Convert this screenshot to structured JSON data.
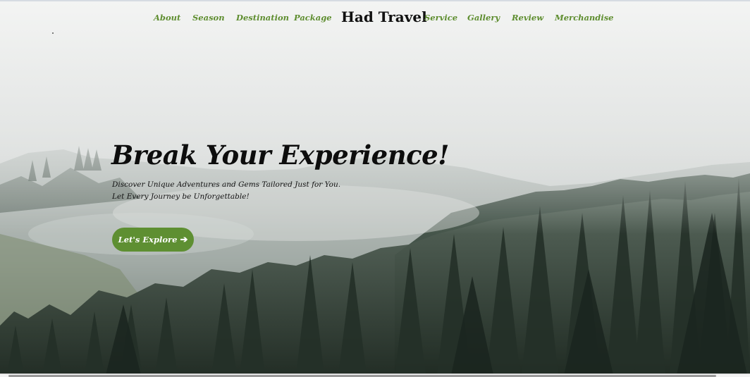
{
  "brand": "Had Travel",
  "nav": {
    "left": [
      "About",
      "Season",
      "Destination",
      "Package"
    ],
    "right": [
      "Service",
      "Gallery",
      "Review",
      "Merchandise"
    ]
  },
  "hero": {
    "headline": "Break Your Experience!",
    "subtitle_line1": "Discover Unique Adventures and Gems Tailored Just for You.",
    "subtitle_line2": "Let Every Journey be Unforgettable!",
    "cta_label": "Let's Explore",
    "cta_icon": "arrow-right-icon"
  },
  "colors": {
    "accent": "#5e8f32",
    "nav_link": "#5e8d2f",
    "headline": "#0d0d0d"
  }
}
